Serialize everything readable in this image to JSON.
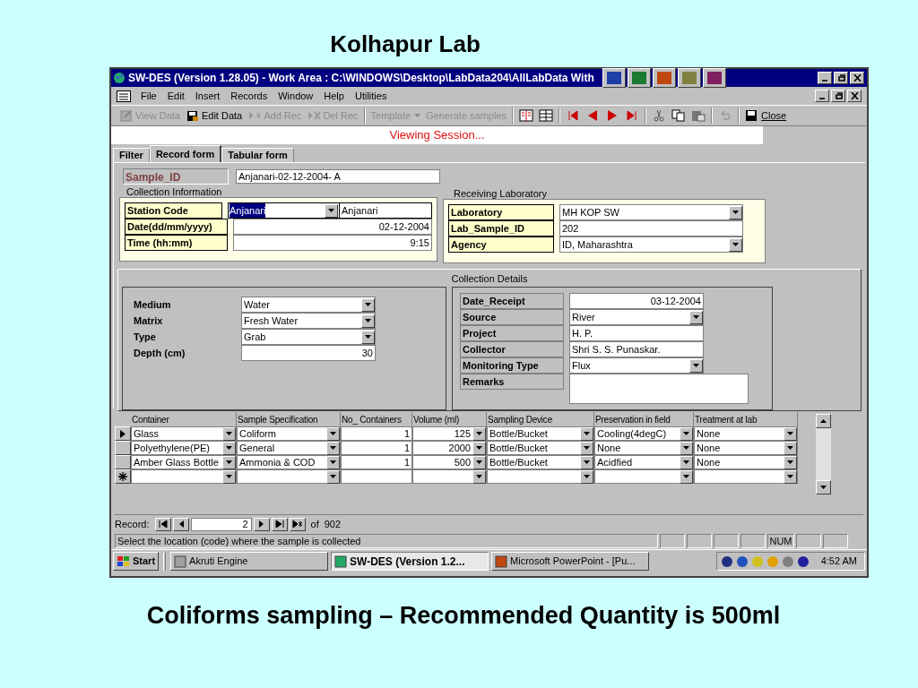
{
  "slide_title": "Kolhapur Lab",
  "window": {
    "title": "SW-DES (Version 1.28.05) - Work Area : C:\\WINDOWS\\Desktop\\LabData204\\AllLabData With"
  },
  "menu": [
    "File",
    "Edit",
    "Insert",
    "Records",
    "Window",
    "Help",
    "Utilities"
  ],
  "toolbar": {
    "buttons": [
      {
        "label": "View Data",
        "disabled": true
      },
      {
        "label": "Edit Data",
        "disabled": false
      },
      {
        "label": "Add Rec",
        "disabled": true
      },
      {
        "label": "Del Rec",
        "disabled": true
      },
      {
        "label": "Template",
        "disabled": true,
        "kind": "menu"
      },
      {
        "label": "Generate samples",
        "disabled": true
      }
    ],
    "close_label": "Close"
  },
  "session_banner": "Viewing Session...",
  "tabs": [
    {
      "label": "Filter",
      "selected": false
    },
    {
      "label": "Record form",
      "selected": true
    },
    {
      "label": "Tabular form",
      "selected": false
    }
  ],
  "sample_id": {
    "label": "Sample_ID",
    "value": "Anjanari-02-12-2004- A"
  },
  "collection_information": {
    "title": "Collection Information",
    "fields": [
      {
        "label": "Station Code",
        "kind": "lookup",
        "value": "Anjanari",
        "text_selected": true,
        "description": "Anjanari"
      },
      {
        "label": "Date(dd/mm/yyyy)",
        "kind": "text",
        "value": "02-12-2004",
        "right_aligned": true
      },
      {
        "label": "Time (hh:mm)",
        "kind": "text",
        "value": "9:15",
        "right_aligned": true
      }
    ]
  },
  "receiving_laboratory": {
    "title": "Receiving Laboratory",
    "fields": [
      {
        "label": "Laboratory",
        "kind": "combo",
        "value": "MH KOP SW"
      },
      {
        "label": "Lab_Sample_ID",
        "kind": "text",
        "value": "202",
        "right_aligned": false
      },
      {
        "label": "Agency",
        "kind": "combo",
        "value": "ID, Maharashtra"
      }
    ]
  },
  "collection_details": {
    "title": "Collection Details",
    "left": [
      {
        "label": "Medium",
        "kind": "combo",
        "value": "Water"
      },
      {
        "label": "Matrix",
        "kind": "combo",
        "value": "Fresh Water"
      },
      {
        "label": "Type",
        "kind": "combo",
        "value": "Grab"
      },
      {
        "label": "Depth (cm)",
        "kind": "text",
        "value": "30",
        "right_aligned": true
      }
    ],
    "right": [
      {
        "label": "Date_Receipt",
        "kind": "text",
        "value": "03-12-2004",
        "right_aligned": true
      },
      {
        "label": "Source",
        "kind": "combo",
        "value": "River"
      },
      {
        "label": "Project",
        "kind": "text",
        "value": "H. P.",
        "right_aligned": false
      },
      {
        "label": "Collector",
        "kind": "text",
        "value": "Shri S. S. Punaskar.",
        "right_aligned": false
      },
      {
        "label": "Monitoring Type",
        "kind": "combo",
        "value": "Flux"
      },
      {
        "label": "Remarks",
        "kind": "memo"
      }
    ]
  },
  "grid": {
    "columns": [
      {
        "label": "Container",
        "dropdown": true,
        "right_aligned": false
      },
      {
        "label": "Sample Specification",
        "dropdown": true,
        "right_aligned": false
      },
      {
        "label": "No_ Containers",
        "dropdown": false,
        "right_aligned": true
      },
      {
        "label": "Volume (ml)",
        "dropdown": true,
        "right_aligned": true
      },
      {
        "label": "Sampling Device",
        "dropdown": true,
        "right_aligned": false
      },
      {
        "label": "Preservation in field",
        "dropdown": true,
        "right_aligned": false
      },
      {
        "label": "Treatment at lab",
        "dropdown": true,
        "right_aligned": false
      }
    ],
    "rows": [
      {
        "kind": "record",
        "selected": true,
        "cells": [
          "Glass",
          "Coliform",
          "1",
          "125",
          "Bottle/Bucket",
          "Cooling(4degC)",
          "None"
        ]
      },
      {
        "kind": "record",
        "selected": false,
        "cells": [
          "Polyethylene(PE)",
          "General",
          "1",
          "2000",
          "Bottle/Bucket",
          "None",
          "None"
        ]
      },
      {
        "kind": "record",
        "selected": false,
        "cells": [
          "Amber Glass Bottle",
          "Ammonia & COD",
          "1",
          "500",
          "Bottle/Bucket",
          "Acidfied",
          "None"
        ]
      },
      {
        "kind": "new",
        "selected": false
      }
    ]
  },
  "record_nav": {
    "label": "Record:",
    "current": "2",
    "of_label": "of",
    "total": "902"
  },
  "status_bar": {
    "message": "Select the location (code) where the sample is collected",
    "indicator": "NUM"
  },
  "taskbar": {
    "start": "Start",
    "tasks": [
      {
        "label": "Akruti Engine",
        "selected": false
      },
      {
        "label": "SW-DES (Version 1.2...",
        "selected": true
      },
      {
        "label": "Microsoft PowerPoint - [Pu...",
        "selected": false
      }
    ],
    "clock": "4:52 AM"
  },
  "caption": "Coliforms sampling – Recommended Quantity is 500ml"
}
